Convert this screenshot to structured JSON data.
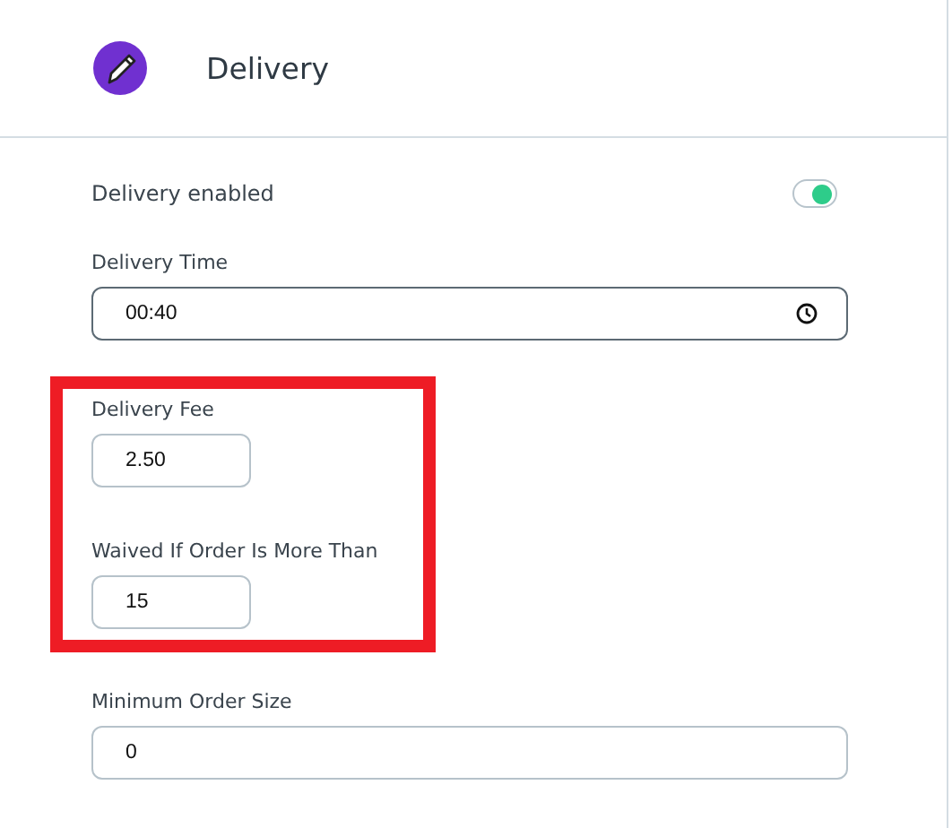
{
  "header": {
    "title": "Delivery"
  },
  "fields": [
    {
      "kind": "toggle",
      "label": "Delivery enabled",
      "on": true,
      "highlighted": false
    },
    {
      "kind": "time",
      "label": "Delivery Time",
      "value": "00:40",
      "highlighted": false
    },
    {
      "kind": "short",
      "label": "Delivery Fee",
      "value": "2.50",
      "highlighted": true
    },
    {
      "kind": "short",
      "label": "Waived If Order Is More Than",
      "value": "15",
      "highlighted": true
    },
    {
      "kind": "wide",
      "label": "Minimum Order Size",
      "value": "0",
      "highlighted": false
    }
  ]
}
